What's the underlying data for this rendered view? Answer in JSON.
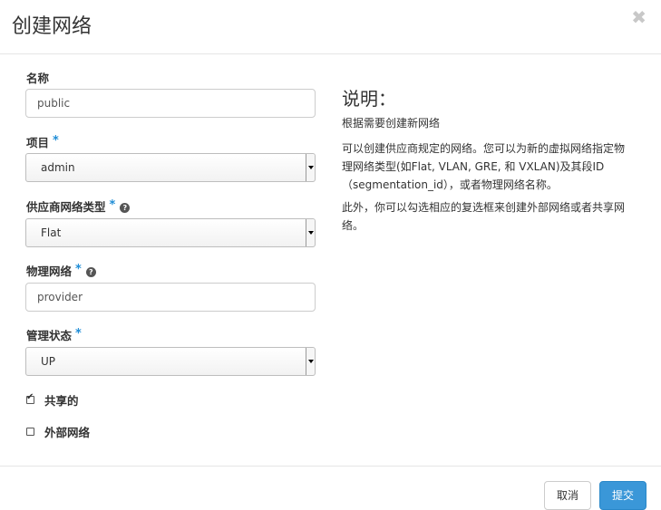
{
  "dialog": {
    "title": "创建网络",
    "close_glyph": "✖"
  },
  "form": {
    "name": {
      "label": "名称",
      "value": "public"
    },
    "project": {
      "label": "项目",
      "required": "*",
      "value": "admin"
    },
    "provider_type": {
      "label": "供应商网络类型",
      "required": "*",
      "help": "?",
      "value": "Flat"
    },
    "physical_network": {
      "label": "物理网络",
      "required": "*",
      "help": "?",
      "value": "provider"
    },
    "admin_state": {
      "label": "管理状态",
      "required": "*",
      "value": "UP"
    },
    "shared": {
      "label": "共享的",
      "checked": true
    },
    "external": {
      "label": "外部网络",
      "checked": false
    }
  },
  "description": {
    "title": "说明：",
    "paragraphs": [
      "根据需要创建新网络",
      "可以创建供应商规定的网络。您可以为新的虚拟网络指定物理网络类型(如Flat, VLAN, GRE, 和 VXLAN)及其段ID（segmentation_id），或者物理网络名称。",
      "此外，你可以勾选相应的复选框来创建外部网络或者共享网络。"
    ]
  },
  "footer": {
    "cancel_label": "取消",
    "submit_label": "提交"
  },
  "colors": {
    "required": "#1f8dd6",
    "primary_button": "#3a97d8",
    "border": "#cccccc"
  },
  "icons": {
    "close": "close-icon",
    "help": "question-circle-icon",
    "dropdown": "caret-down-icon",
    "checkbox_checked": "checkmark-icon"
  }
}
